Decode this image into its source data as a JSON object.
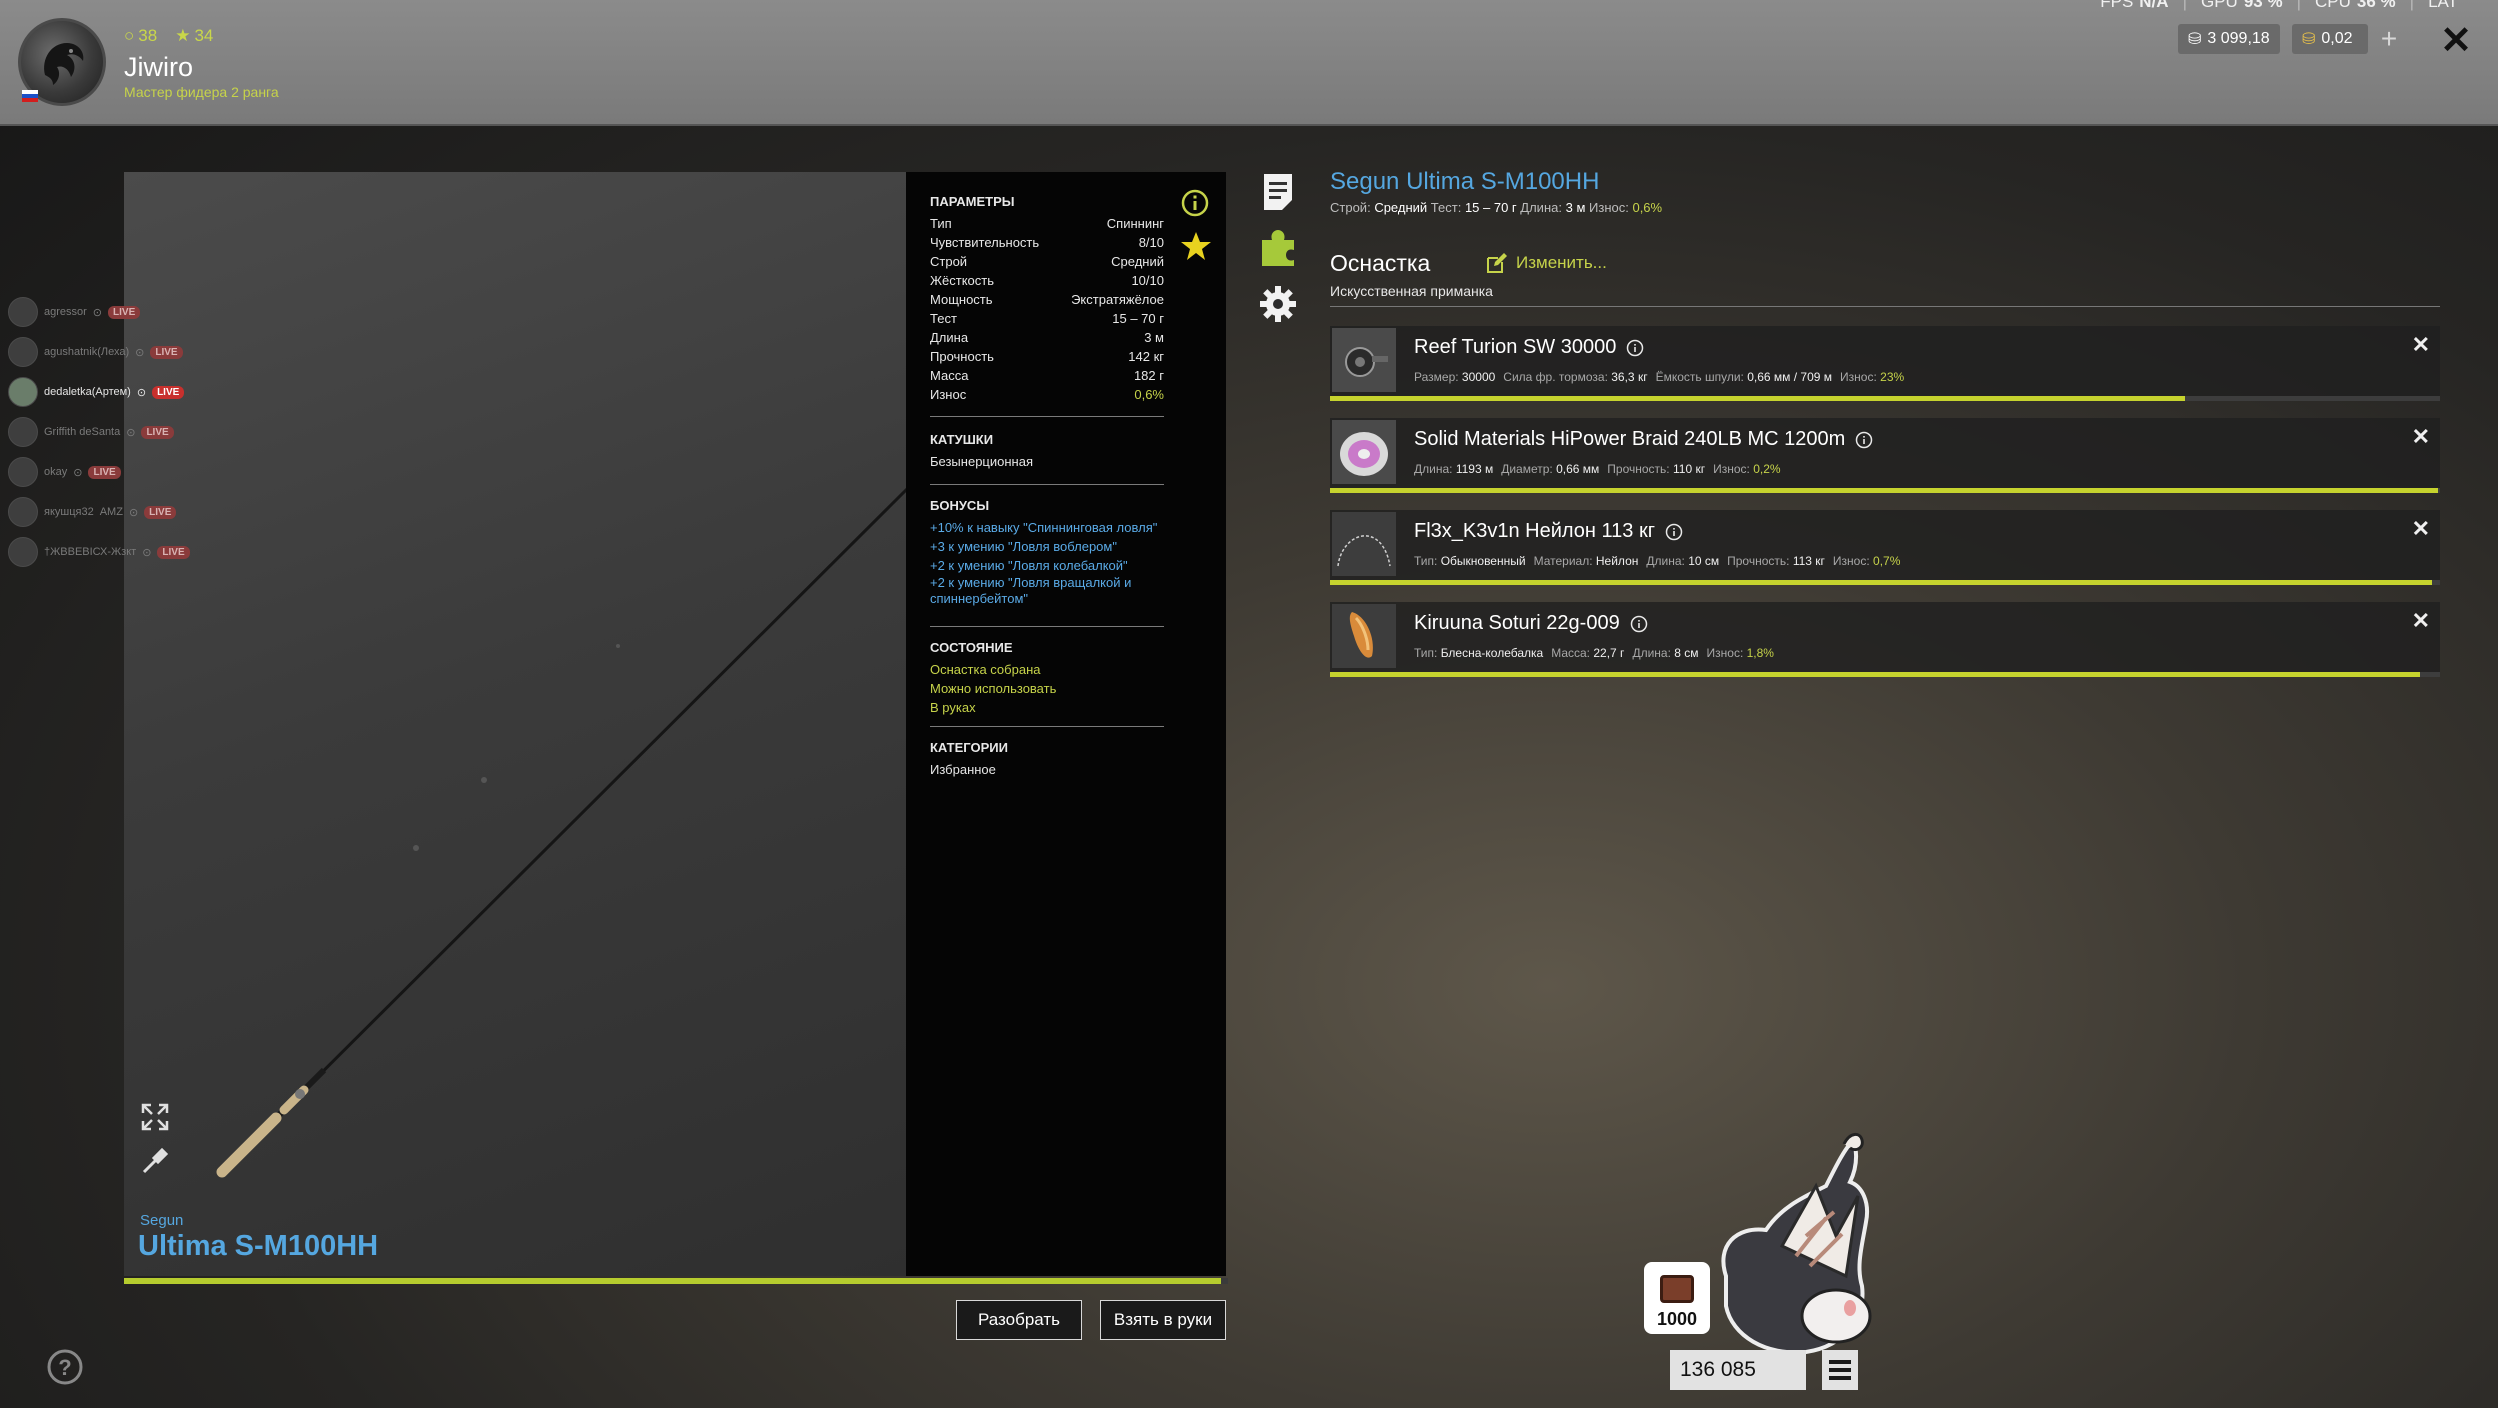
{
  "player": {
    "name": "Jiwiro",
    "rank": "Мастер фидера 2 ранга",
    "level": "38",
    "stars": "34"
  },
  "hud": {
    "fps_label": "FPS",
    "fps_value": "N/A",
    "gpu_label": "GPU",
    "gpu_value": "93 %",
    "cpu_label": "CPU",
    "cpu_value": "36 %",
    "lat_label": "LAT",
    "silver": "3 099,18",
    "gold": "0,02",
    "plus": "+",
    "close": "✕"
  },
  "streams": [
    {
      "name": "agressor",
      "live": "LIVE",
      "active": false
    },
    {
      "name": "agushatnik(Леха)",
      "live": "LIVE",
      "active": false
    },
    {
      "name": "dedaletka(Артем)",
      "live": "LIVE",
      "active": true
    },
    {
      "name": "Griffith deSanta",
      "live": "LIVE",
      "active": false
    },
    {
      "name": "okay",
      "live": "LIVE",
      "active": false
    },
    {
      "name": "якушця32",
      "extra": "AMZ",
      "live": "LIVE",
      "active": false
    },
    {
      "name": "†ЖВВЕВІСХ-Жзкт",
      "live": "LIVE",
      "active": false
    }
  ],
  "rod": {
    "brand": "Segun",
    "model": "Ultima S-M100HH",
    "wear_fraction": 0.994
  },
  "params": {
    "header": "ПАРАМЕТРЫ",
    "rows": [
      {
        "k": "Тип",
        "v": "Спиннинг"
      },
      {
        "k": "Чувствительность",
        "v": "8/10"
      },
      {
        "k": "Строй",
        "v": "Средний"
      },
      {
        "k": "Жёсткость",
        "v": "10/10"
      },
      {
        "k": "Мощность",
        "v": "Экстратяжёлое"
      },
      {
        "k": "Тест",
        "v": "15 – 70 г"
      },
      {
        "k": "Длина",
        "v": "3 м"
      },
      {
        "k": "Прочность",
        "v": "142 кг"
      },
      {
        "k": "Масса",
        "v": "182 г"
      },
      {
        "k": "Износ",
        "v": "0,6%"
      }
    ],
    "reels_header": "КАТУШКИ",
    "reels_value": "Безынерционная",
    "bonus_header": "БОНУСЫ",
    "bonuses": [
      "+10% к навыку \"Спиннинговая ловля\"",
      "+3 к умению \"Ловля воблером\"",
      "+2 к умению \"Ловля колебалкой\"",
      "+2 к умению \"Ловля вращалкой и спиннербейтом\""
    ],
    "state_header": "СОСТОЯНИЕ",
    "states": [
      "Оснастка собрана",
      "Можно использовать",
      "В руках"
    ],
    "cat_header": "КАТЕГОРИИ",
    "cat_value": "Избранное"
  },
  "detail": {
    "title": "Segun Ultima S-M100HH",
    "sub_action_label": "Строй:",
    "sub_action": "Средний",
    "sub_test_label": "Тест:",
    "sub_test": "15 – 70 г",
    "sub_len_label": "Длина:",
    "sub_len": "3 м",
    "sub_wear_label": "Износ:",
    "sub_wear": "0,6%",
    "rig_title": "Оснастка",
    "rig_edit": "Изменить...",
    "rig_type": "Искусственная приманка"
  },
  "items": [
    {
      "name": "Reef Turion SW 30000",
      "stats": [
        {
          "k": "Размер:",
          "v": "30000"
        },
        {
          "k": "Сила фр. тормоза:",
          "v": "36,3 кг"
        },
        {
          "k": "Ёмкость шпули:",
          "v": "0,66 мм / 709 м"
        },
        {
          "k": "Износ:",
          "v": "23%",
          "accent": true
        }
      ],
      "condition": 0.77
    },
    {
      "name": "Solid Materials HiPower Braid 240LB MC 1200m",
      "stats": [
        {
          "k": "Длина:",
          "v": "1193 м"
        },
        {
          "k": "Диаметр:",
          "v": "0,66 мм"
        },
        {
          "k": "Прочность:",
          "v": "110 кг"
        },
        {
          "k": "Износ:",
          "v": "0,2%",
          "accent": true
        }
      ],
      "condition": 0.998
    },
    {
      "name": "Fl3x_K3v1n Нейлон 113 кг",
      "stats": [
        {
          "k": "Тип:",
          "v": "Обыкновенный"
        },
        {
          "k": "Материал:",
          "v": "Нейлон"
        },
        {
          "k": "Длина:",
          "v": "10 см"
        },
        {
          "k": "Прочность:",
          "v": "113 кг"
        },
        {
          "k": "Износ:",
          "v": "0,7%",
          "accent": true
        }
      ],
      "condition": 0.993
    },
    {
      "name": "Kiruuna Soturi 22g-009",
      "stats": [
        {
          "k": "Тип:",
          "v": "Блесна-колебалка"
        },
        {
          "k": "Масса:",
          "v": "22,7 г"
        },
        {
          "k": "Длина:",
          "v": "8 см"
        },
        {
          "k": "Износ:",
          "v": "1,8%",
          "accent": true
        }
      ],
      "condition": 0.982
    }
  ],
  "buttons": {
    "disassemble": "Разобрать",
    "take": "Взять в руки"
  },
  "widget": {
    "chest_count": "1000",
    "money": "136 085"
  },
  "colors": {
    "accent_blue": "#55a7e0",
    "accent_green": "#c6d34a"
  }
}
